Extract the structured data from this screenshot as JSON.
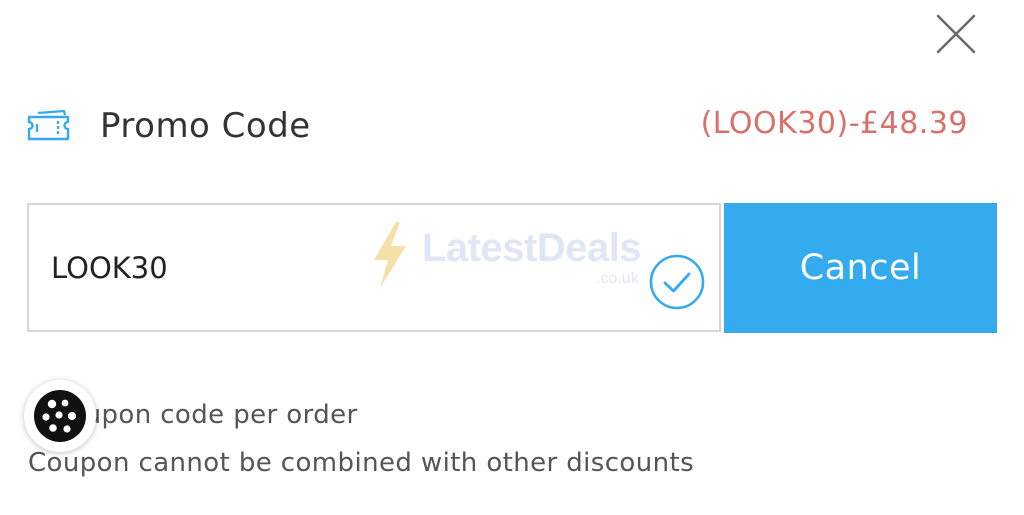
{
  "dialog": {
    "promo": {
      "title": "Promo Code",
      "applied_discount": "(LOOK30)-£48.39",
      "icon": "ticket-icon"
    },
    "code_input": {
      "value": "LOOK30",
      "status_icon": "check-circle-icon"
    },
    "cancel_label": "Cancel",
    "notes": [
      "1 coupon code per order",
      "Coupon cannot be combined with other discounts"
    ],
    "close_icon": "close-icon"
  },
  "watermark": {
    "brand": "LatestDeals",
    "domain": ".co.uk"
  },
  "cookie_button": {
    "icon": "cookie-icon"
  },
  "colors": {
    "accent": "#34aaef",
    "discount": "#d9706c",
    "text": "#333333",
    "muted": "#555555",
    "border": "#d6d6d6"
  }
}
